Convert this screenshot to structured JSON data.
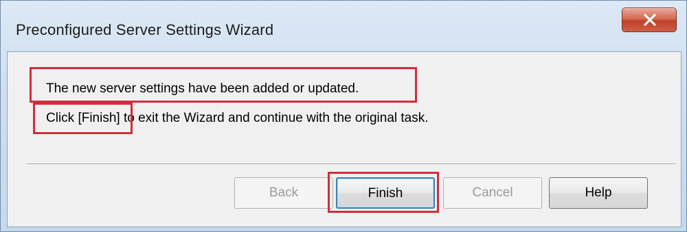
{
  "window": {
    "title": "Preconfigured Server Settings Wizard"
  },
  "message": {
    "line1": "The new server settings have been added or updated.",
    "line2": "Click [Finish] to exit the Wizard and continue with the original task."
  },
  "buttons": {
    "back": "Back",
    "finish": "Finish",
    "cancel": "Cancel",
    "help": "Help"
  },
  "colors": {
    "highlight": "#d12c3a",
    "close_button": "#c0402a"
  },
  "icons": {
    "close": "close-icon"
  }
}
